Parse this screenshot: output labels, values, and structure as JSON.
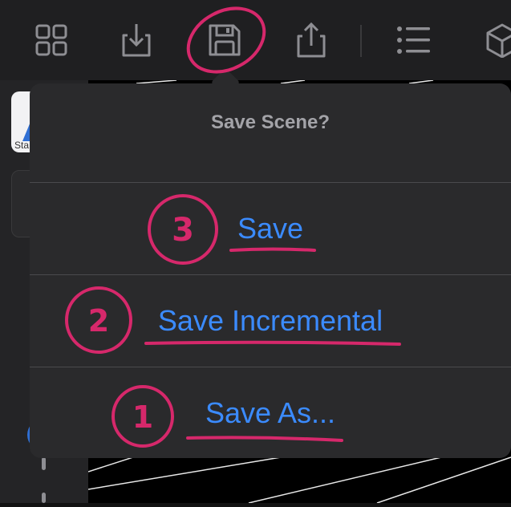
{
  "toolbar": {
    "icons": [
      "grid-icon",
      "import-icon",
      "save-icon",
      "share-icon",
      "list-icon",
      "cube-icon"
    ]
  },
  "left_rail": {
    "scene_thumb_label": "Sta"
  },
  "popover": {
    "title": "Save Scene?",
    "options": [
      {
        "label": "Save",
        "annotation_number": "3"
      },
      {
        "label": "Save Incremental",
        "annotation_number": "2"
      },
      {
        "label": "Save As...",
        "annotation_number": "1"
      }
    ]
  },
  "colors": {
    "annotation": "#d6286b",
    "option_text": "#3b8bff",
    "popover_bg": "#2a2a2c"
  }
}
